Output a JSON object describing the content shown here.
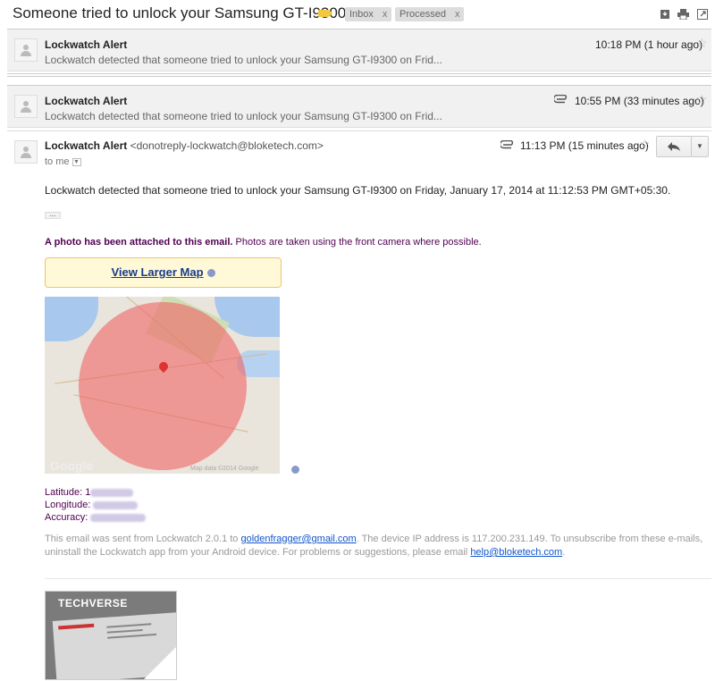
{
  "thread": {
    "subject": "Someone tried to unlock your Samsung GT-I9300",
    "labels": [
      {
        "name": "Inbox",
        "remove": "x"
      },
      {
        "name": "Processed",
        "remove": "x"
      }
    ]
  },
  "messages": [
    {
      "sender": "Lockwatch Alert",
      "snippet": "Lockwatch detected that someone tried to unlock your Samsung GT-I9300 on Frid...",
      "time": "10:18 PM (1 hour ago)"
    },
    {
      "sender": "Lockwatch Alert",
      "snippet": "Lockwatch detected that someone tried to unlock your Samsung GT-I9300 on Frid...",
      "time": "10:55 PM (33 minutes ago)"
    }
  ],
  "open_message": {
    "sender": "Lockwatch Alert",
    "sender_email": "<donotreply-lockwatch@bloketech.com>",
    "to": "to me",
    "time": "11:13 PM (15 minutes ago)",
    "body": "Lockwatch detected that someone tried to unlock your Samsung GT-I9300 on Friday, January 17, 2014 at 11:12:53 PM GMT+05:30.",
    "photo_bold": "A photo has been attached to this email.",
    "photo_rest": " Photos are taken using the front camera where possible.",
    "map_link": "View Larger Map",
    "map_credit": "Map data ©2014 Google",
    "map_logo": "Google",
    "latitude_label": "Latitude:",
    "latitude_value": "1",
    "longitude_label": "Longitude:",
    "accuracy_label": "Accuracy:",
    "footer_1": "This email was sent from Lockwatch 2.0.1 to ",
    "footer_email": "goldenfragger@gmail.com",
    "footer_2": ". The device IP address is 117.200.231.149. To unsubscribe from these e-mails, uninstall the Lockwatch app from your Android device. For problems or suggestions, please email ",
    "footer_help": "help@bloketech.com",
    "footer_3": ".",
    "attachment_brand": "TECHVERSE"
  },
  "icons": {
    "label": "label-tag-icon",
    "download": "download-icon",
    "print": "print-icon",
    "newwindow": "new-window-icon",
    "star": "star-icon",
    "attachment": "paperclip-icon",
    "reply": "reply-icon",
    "more": "chevron-down-icon"
  },
  "colors": {
    "link": "#1a3b8a",
    "purple_text": "#500050",
    "map_radius": "#f06464",
    "label_tag": "#f3c840"
  }
}
